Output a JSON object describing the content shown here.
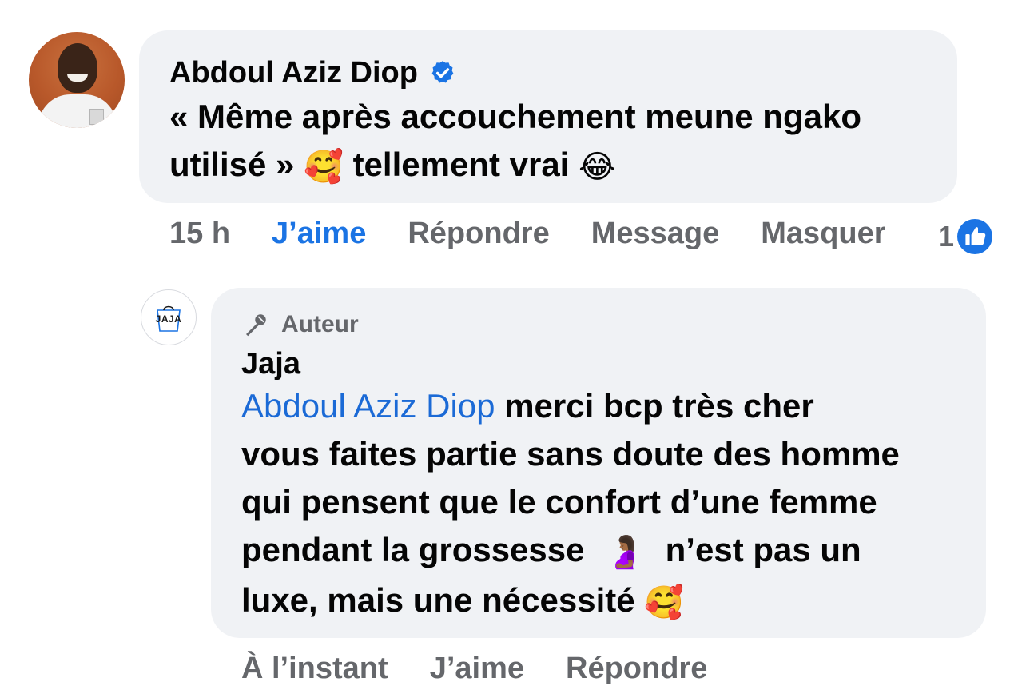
{
  "comment": {
    "author": "Abdoul Aziz Diop",
    "text_line1": "« Même après accouchement meune ngako",
    "text_line2_a": "utilisé »",
    "emoji_1": "🥰",
    "text_line2_b": "tellement vrai",
    "emoji_2": "😂",
    "time": "15 h",
    "like_label": "J’aime",
    "reply_label": "Répondre",
    "message_label": "Message",
    "hide_label": "Masquer",
    "like_count": "1"
  },
  "reply": {
    "avatar_logo_text": "JAJA",
    "badge_label": "Auteur",
    "author": "Jaja",
    "mention": "Abdoul Aziz Diop",
    "text_line1": "merci bcp très cher",
    "text_line2": "vous faites partie sans doute des homme",
    "text_line3": "qui pensent que le confort d’une femme",
    "text_line4_a": "pendant la grossesse",
    "emoji_pregnant": "🤰🏾",
    "text_line4_b": "n’est pas un",
    "text_line5": "luxe, mais une nécessité",
    "emoji_end": "🥰",
    "time": "À l’instant",
    "like_label": "J’aime",
    "reply_label": "Répondre"
  },
  "colors": {
    "bubble": "#f0f2f5",
    "link_blue": "#1b74e4",
    "secondary_text": "#65676b"
  }
}
